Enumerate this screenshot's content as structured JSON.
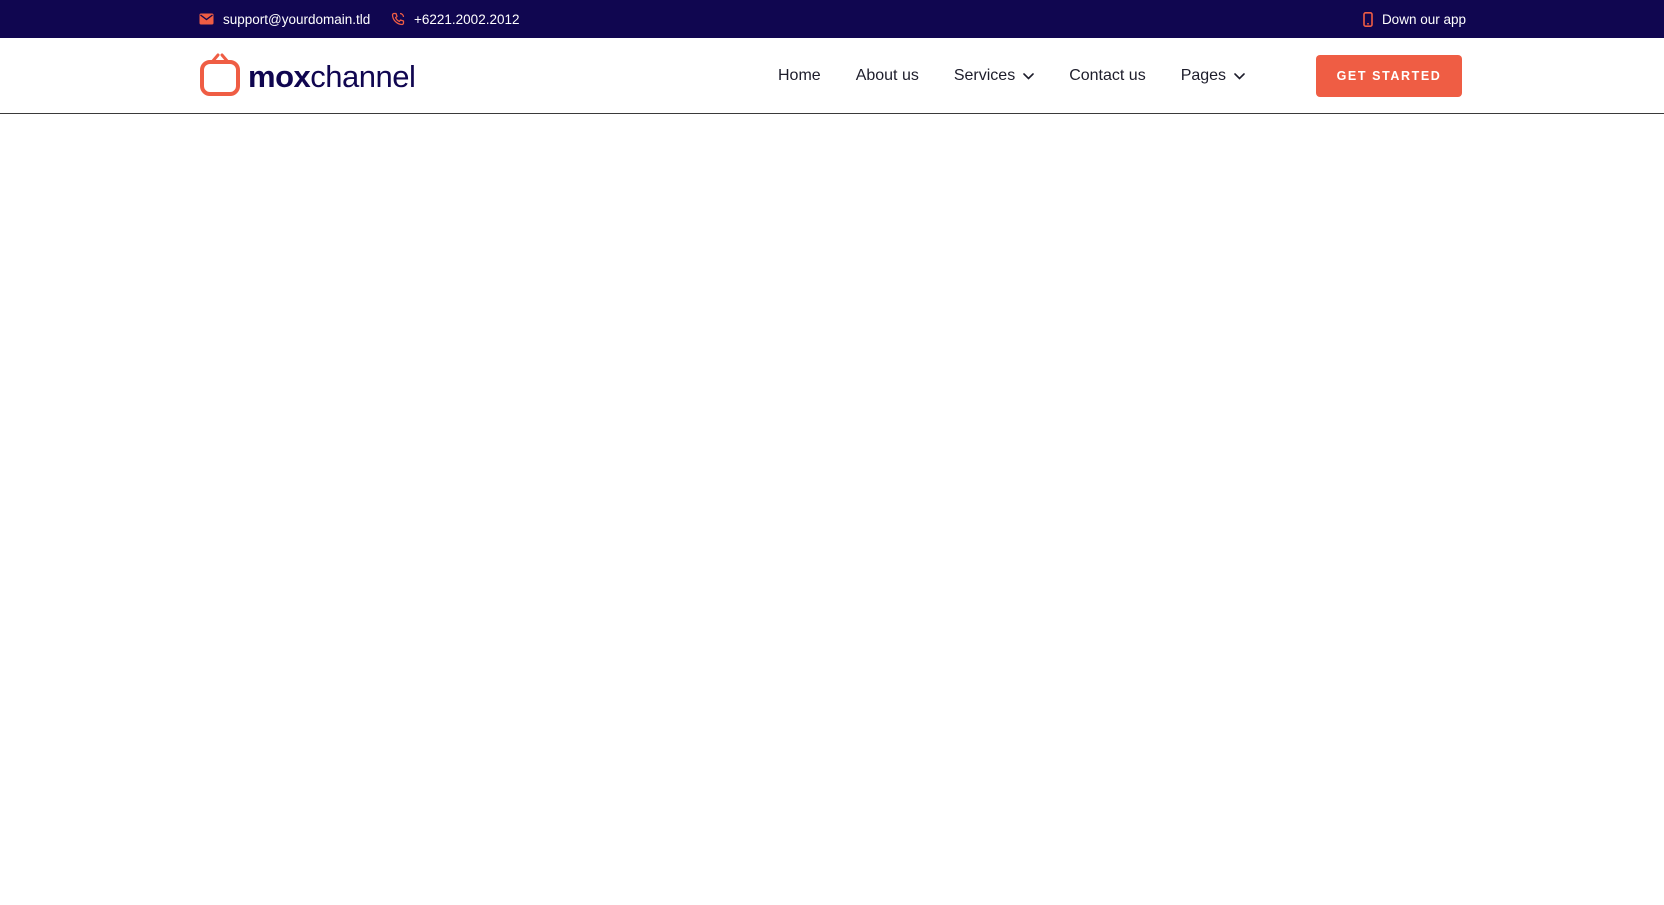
{
  "topbar": {
    "email": "support@yourdomain.tld",
    "phone": "+6221.2002.2012",
    "app_link": "Down our app",
    "icons": {
      "email": "envelope-icon",
      "phone": "phone-icon",
      "app": "smartphone-icon"
    }
  },
  "brand": {
    "name_bold": "mox",
    "name_light": "channel",
    "logo_icon": "tv-icon"
  },
  "nav": {
    "items": [
      {
        "label": "Home"
      },
      {
        "label": "About us"
      },
      {
        "label": "Services",
        "dropdown": true
      },
      {
        "label": "Contact us"
      },
      {
        "label": "Pages",
        "dropdown": true
      }
    ],
    "cta_label": "GET STARTED"
  },
  "colors": {
    "topbar_bg": "#100650",
    "accent": "#ef5d44",
    "brand_text": "#100650",
    "nav_text": "#1d1d2b"
  }
}
